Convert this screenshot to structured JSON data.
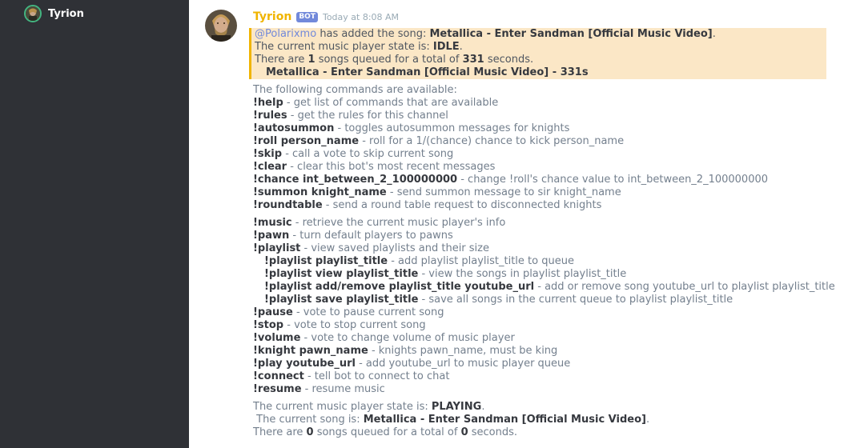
{
  "sidebar": {
    "member_name": "Tyrion"
  },
  "message": {
    "author": "Tyrion",
    "bot_tag": "BOT",
    "timestamp": "Today at 8:08 AM"
  },
  "embed": {
    "mention": "@Polarixmo",
    "added_text": " has added the song: ",
    "song": "Metallica - Enter Sandman [Official Music Video]",
    "state_prefix": "The current music player state is: ",
    "state": "IDLE",
    "queue_prefix": "There are ",
    "queue_count": "1",
    "queue_mid": " songs queued for a total of ",
    "queue_seconds": "331",
    "queue_suffix": " seconds.",
    "queued_item": "Metallica - Enter Sandman [Official Music Video] - 331s"
  },
  "commands_intro": "The following commands are available:",
  "commands_a": [
    {
      "cmd": "!help",
      "desc": " - get list of commands that are available"
    },
    {
      "cmd": "!rules",
      "desc": " - get the rules for this channel"
    },
    {
      "cmd": "!autosummon",
      "desc": " - toggles autosummon messages for knights"
    },
    {
      "cmd": "!roll person_name",
      "desc": " - roll for a 1/(chance) chance to kick person_name"
    },
    {
      "cmd": "!skip",
      "desc": " - call a vote to skip current song"
    },
    {
      "cmd": "!clear",
      "desc": " - clear this bot's most recent messages"
    },
    {
      "cmd": "!chance int_between_2_100000000",
      "desc": " - change !roll's chance value to int_between_2_100000000"
    },
    {
      "cmd": "!summon knight_name",
      "desc": " - send summon message to sir knight_name"
    },
    {
      "cmd": "!roundtable",
      "desc": " - send a round table request to disconnected knights"
    }
  ],
  "commands_b": [
    {
      "cmd": "!music",
      "desc": " - retrieve the current music player's info"
    },
    {
      "cmd": "!pawn",
      "desc": " - turn default players to pawns"
    },
    {
      "cmd": "!playlist",
      "desc": " - view saved playlists and their size"
    },
    {
      "cmd": "!playlist playlist_title",
      "desc": " - add playlist playlist_title to queue",
      "indent": true
    },
    {
      "cmd": "!playlist view playlist_title",
      "desc": " - view the songs in playlist playlist_title",
      "indent": true
    },
    {
      "cmd": "!playlist add/remove playlist_title youtube_url",
      "desc": " - add or remove song youtube_url to playlist playlist_title",
      "indent": true
    },
    {
      "cmd": "!playlist save playlist_title",
      "desc": " - save all songs in the current queue to playlist playlist_title",
      "indent": true
    },
    {
      "cmd": "!pause",
      "desc": " - vote to pause current song"
    },
    {
      "cmd": "!stop",
      "desc": " - vote to stop current song"
    },
    {
      "cmd": "!volume",
      "desc": " - vote to change volume of music player"
    },
    {
      "cmd": "!knight pawn_name",
      "desc": " - knights pawn_name, must be king"
    },
    {
      "cmd": "!play youtube_url",
      "desc": " - add youtube_url to music player queue"
    },
    {
      "cmd": "!connect",
      "desc": " - tell bot to connect to chat"
    },
    {
      "cmd": "!resume",
      "desc": " - resume music"
    }
  ],
  "status": {
    "state_prefix": "The current music player state is: ",
    "state": "PLAYING",
    "state_suffix": ".",
    "song_prefix": " The current song is: ",
    "song": "Metallica - Enter Sandman [Official Music Video]",
    "song_suffix": ".",
    "queue_prefix": "There are ",
    "queue_count": "0",
    "queue_mid": " songs queued for a total of ",
    "queue_seconds": "0",
    "queue_suffix": " seconds."
  }
}
